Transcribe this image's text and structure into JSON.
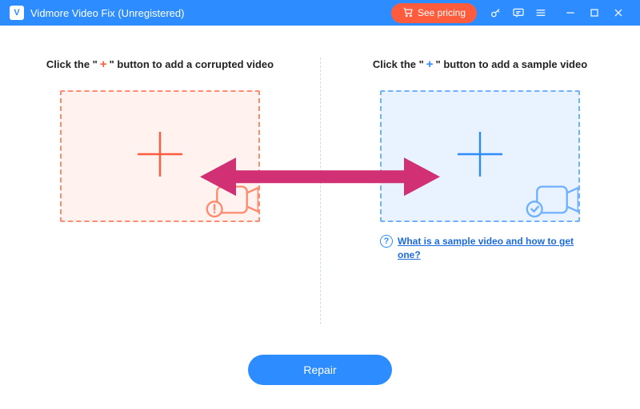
{
  "titlebar": {
    "app_title": "Vidmore Video Fix (Unregistered)",
    "pricing_label": "See pricing"
  },
  "left_panel": {
    "title_prefix": "Click the \"",
    "title_plus": "+",
    "title_suffix": "\" button to add a corrupted video"
  },
  "right_panel": {
    "title_prefix": "Click the \"",
    "title_plus": "+",
    "title_suffix": "\" button to add a sample video",
    "help_text": "What is a sample video and how to get one?",
    "help_symbol": "?"
  },
  "footer": {
    "repair_label": "Repair"
  },
  "colors": {
    "accent": "#2d8cff",
    "danger": "#ff5c3e",
    "arrow": "#d13075"
  }
}
